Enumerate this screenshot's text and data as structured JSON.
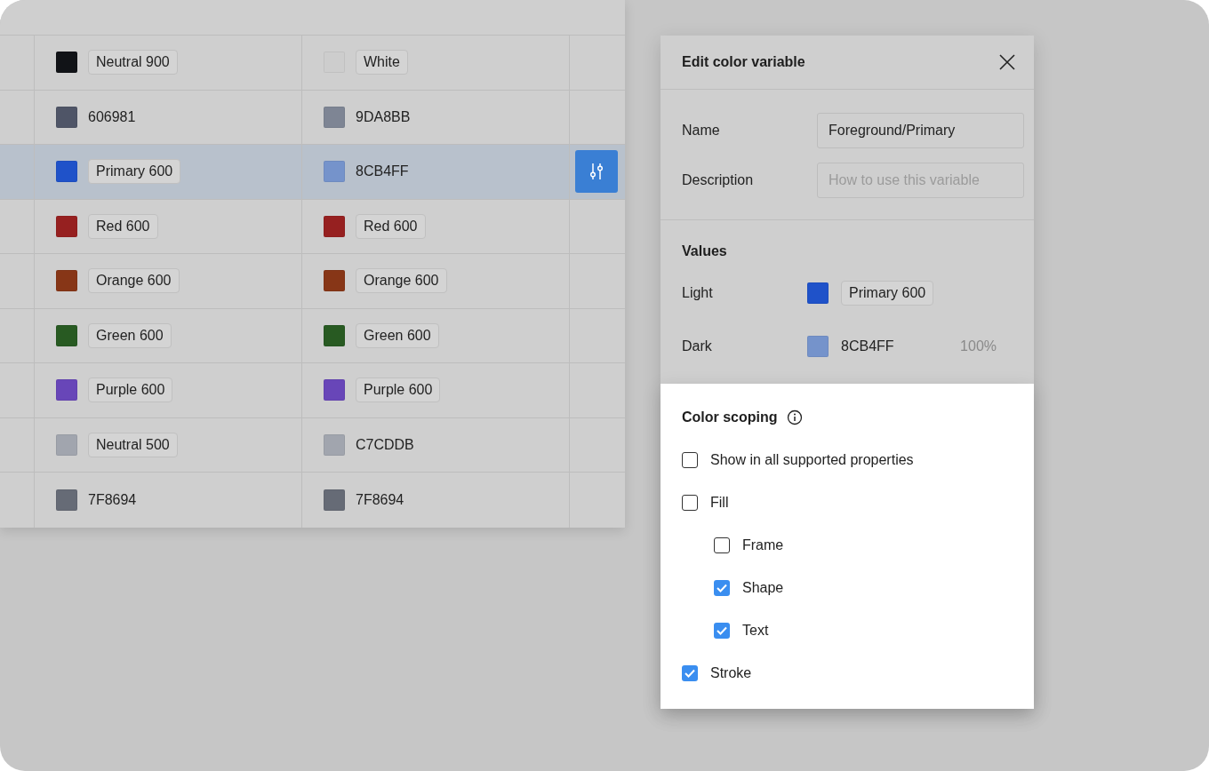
{
  "table": {
    "rows": [
      {
        "selected": false,
        "cells": [
          {
            "kind": "token",
            "color": "#111317",
            "text": "Neutral 900"
          },
          {
            "kind": "token",
            "color": "#cdcdcd",
            "text": "White"
          }
        ]
      },
      {
        "selected": false,
        "cells": [
          {
            "kind": "hex",
            "color": "#4f5567",
            "text": "606981"
          },
          {
            "kind": "hex",
            "color": "#7e8594",
            "text": "9DA8BB"
          }
        ]
      },
      {
        "selected": true,
        "cells": [
          {
            "kind": "token",
            "color": "#1f52c9",
            "text": "Primary 600"
          },
          {
            "kind": "hex",
            "color": "#7593cb",
            "text": "8CB4FF"
          }
        ]
      },
      {
        "selected": false,
        "cells": [
          {
            "kind": "token",
            "color": "#962020",
            "text": "Red 600"
          },
          {
            "kind": "token",
            "color": "#962020",
            "text": "Red 600"
          }
        ]
      },
      {
        "selected": false,
        "cells": [
          {
            "kind": "token",
            "color": "#873617",
            "text": "Orange 600"
          },
          {
            "kind": "token",
            "color": "#873617",
            "text": "Orange 600"
          }
        ]
      },
      {
        "selected": false,
        "cells": [
          {
            "kind": "token",
            "color": "#285a22",
            "text": "Green 600"
          },
          {
            "kind": "token",
            "color": "#285a22",
            "text": "Green 600"
          }
        ]
      },
      {
        "selected": false,
        "cells": [
          {
            "kind": "token",
            "color": "#6846b8",
            "text": "Purple 600"
          },
          {
            "kind": "token",
            "color": "#6846b8",
            "text": "Purple 600"
          }
        ]
      },
      {
        "selected": false,
        "cells": [
          {
            "kind": "token",
            "color": "#a1a5ae",
            "text": "Neutral 500"
          },
          {
            "kind": "hex",
            "color": "#a1a5ae",
            "text": "C7CDDB"
          }
        ]
      },
      {
        "selected": false,
        "cells": [
          {
            "kind": "hex",
            "color": "#666b76",
            "text": "7F8694"
          },
          {
            "kind": "hex",
            "color": "#666b76",
            "text": "7F8694"
          }
        ]
      }
    ]
  },
  "panel": {
    "title": "Edit color variable",
    "fields": [
      {
        "label": "Name",
        "value": "Foreground/Primary"
      },
      {
        "label": "Description",
        "placeholder": "How to use this variable"
      }
    ],
    "values_title": "Values",
    "values": [
      {
        "label": "Light",
        "kind": "token",
        "color": "#1f52c9",
        "text": "Primary 600"
      },
      {
        "label": "Dark",
        "kind": "hex",
        "color": "#7593cb",
        "text": "8CB4FF",
        "opacity": "100%"
      }
    ],
    "scoping": {
      "title": "Color scoping",
      "options": [
        {
          "label": "Show in all supported properties",
          "checked": false
        },
        {
          "label": "Fill",
          "checked": false,
          "children": [
            {
              "label": "Frame",
              "checked": false
            },
            {
              "label": "Shape",
              "checked": true
            },
            {
              "label": "Text",
              "checked": true
            }
          ]
        },
        {
          "label": "Stroke",
          "checked": true
        }
      ]
    }
  }
}
